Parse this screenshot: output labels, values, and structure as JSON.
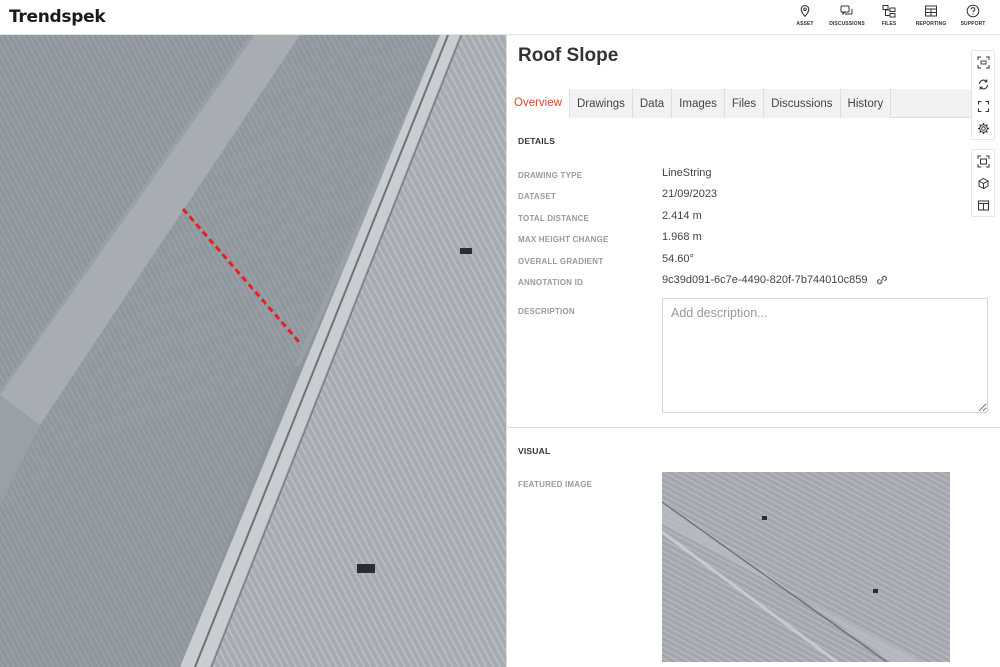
{
  "app": {
    "logo": "Trendspek",
    "nav": [
      {
        "label": "ASSET",
        "icon": "location-pin-icon"
      },
      {
        "label": "DISCUSSIONS",
        "icon": "chat-bubbles-icon"
      },
      {
        "label": "FILES",
        "icon": "folder-tree-icon"
      },
      {
        "label": "REPORTING",
        "icon": "table-icon"
      },
      {
        "label": "SUPPORT",
        "icon": "help-circle-icon"
      }
    ]
  },
  "panel": {
    "title": "Roof Slope",
    "tabs": [
      "Overview",
      "Drawings",
      "Data",
      "Images",
      "Files",
      "Discussions",
      "History"
    ],
    "active_tab": "Overview",
    "details_heading": "DETAILS",
    "details": [
      {
        "label": "DRAWING TYPE",
        "value": "LineString"
      },
      {
        "label": "DATASET",
        "value": "21/09/2023"
      },
      {
        "label": "TOTAL DISTANCE",
        "value": "2.414 m"
      },
      {
        "label": "MAX HEIGHT CHANGE",
        "value": "1.968 m"
      },
      {
        "label": "OVERALL GRADIENT",
        "value": "54.60°"
      },
      {
        "label": "ANNOTATION ID",
        "value": "9c39d091-6c7e-4490-820f-7b744010c859"
      }
    ],
    "description_label": "DESCRIPTION",
    "description_placeholder": "Add description...",
    "visual_heading": "VISUAL",
    "featured_image_label": "FEATURED IMAGE"
  },
  "toolbar": {
    "group1": [
      "capture-icon",
      "refresh-icon",
      "fullscreen-icon",
      "settings-icon"
    ],
    "group2": [
      "screenshot-icon",
      "cube-icon",
      "split-view-icon"
    ]
  },
  "colors": {
    "accent": "#e0452c",
    "annotation_line": "#e8201c"
  }
}
